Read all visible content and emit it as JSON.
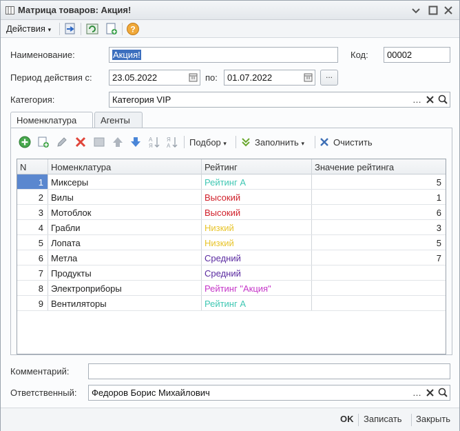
{
  "window": {
    "title": "Матрица товаров: Акция!"
  },
  "toolbar": {
    "actions_label": "Действия"
  },
  "form": {
    "name_label": "Наименование:",
    "name_value": "Акция!",
    "code_label": "Код:",
    "code_value": "00002",
    "period_label": "Период действия с:",
    "period_from": "23.05.2022",
    "period_to_label": "по:",
    "period_to": "01.07.2022",
    "period_more": "...",
    "category_label": "Категория:",
    "category_value": "Категория VIP",
    "comment_label": "Комментарий:",
    "comment_value": "",
    "responsible_label": "Ответственный:",
    "responsible_value": "Федоров Борис Михайлович"
  },
  "tabs": [
    {
      "label": "Номенклатура"
    },
    {
      "label": "Агенты"
    }
  ],
  "table_toolbar": {
    "pick_label": "Подбор",
    "fill_label": "Заполнить",
    "clear_label": "Очистить"
  },
  "table": {
    "columns": [
      "N",
      "Номенклатура",
      "Рейтинг",
      "Значение рейтинга"
    ],
    "rows": [
      {
        "n": "1",
        "name": "Миксеры",
        "rating": "Рейтинг А",
        "rating_color": "#3fc7b3",
        "value": "5"
      },
      {
        "n": "2",
        "name": "Вилы",
        "rating": "Высокий",
        "rating_color": "#d0202a",
        "value": "1"
      },
      {
        "n": "3",
        "name": "Мотоблок",
        "rating": "Высокий",
        "rating_color": "#d0202a",
        "value": "6"
      },
      {
        "n": "4",
        "name": "Грабли",
        "rating": "Низкий",
        "rating_color": "#e8c42a",
        "value": "3"
      },
      {
        "n": "5",
        "name": "Лопата",
        "rating": "Низкий",
        "rating_color": "#e8c42a",
        "value": "5"
      },
      {
        "n": "6",
        "name": "Метла",
        "rating": "Средний",
        "rating_color": "#5a2aa0",
        "value": "7"
      },
      {
        "n": "7",
        "name": "Продукты",
        "rating": "Средний",
        "rating_color": "#5a2aa0",
        "value": ""
      },
      {
        "n": "8",
        "name": "Электроприборы",
        "rating": "Рейтинг \"Акция\"",
        "rating_color": "#c535c8",
        "value": ""
      },
      {
        "n": "9",
        "name": "Вентиляторы",
        "rating": "Рейтинг А",
        "rating_color": "#3fc7b3",
        "value": ""
      }
    ]
  },
  "footer": {
    "ok_label": "OK",
    "save_label": "Записать",
    "close_label": "Закрыть"
  },
  "colors": {
    "selection": "#3c6fbe",
    "row_selected": "#5a87cf"
  }
}
